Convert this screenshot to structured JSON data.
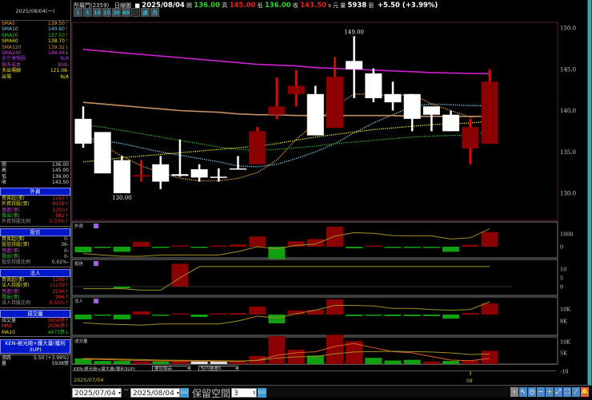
{
  "header": {
    "date": "2025/08/04(一)",
    "stock": "所羅門(2359)",
    "chart_type": "日線圖",
    "bar_date": "2025/08/04",
    "open_label": "開",
    "open": "136.00",
    "high_label": "高",
    "high": "145.00",
    "low_label": "低",
    "low": "136.00",
    "close_label": "收",
    "close": "143.50",
    "unit": "s 元",
    "vol_label": "量",
    "volume": "5938",
    "vol_unit": "張",
    "change": "+5.50 (+3.99%)",
    "intervals": [
      "1",
      "5",
      "10",
      "15",
      "30",
      "60",
      "日",
      "週",
      "月"
    ]
  },
  "indicators": [
    {
      "name": "SMA5",
      "value": "139.50",
      "trend": "↑",
      "color": "#e8a040"
    },
    {
      "name": "SMA10",
      "value": "140.60",
      "trend": "↑",
      "color": "#80c8f0"
    },
    {
      "name": "SMA20",
      "value": "137.50",
      "trend": "↑",
      "color": "#30c030"
    },
    {
      "name": "SMA60",
      "value": "138.70",
      "trend": "↑",
      "color": "#e8e020"
    },
    {
      "name": "SMA120",
      "value": "139.32",
      "trend": "↓",
      "color": "#c89060"
    },
    {
      "name": "SMA240",
      "value": "144.46",
      "trend": "↓",
      "color": "#d040e0"
    },
    {
      "name": "多空達陣圈",
      "value": "N/A",
      "trend": "",
      "color": "#a040e0"
    },
    {
      "name": "做多成本",
      "value": "858",
      "trend": "-",
      "color": "#c040c0"
    },
    {
      "name": "多出場線",
      "value": "121.08",
      "trend": "-",
      "color": "#e8e020"
    },
    {
      "name": "出場",
      "value": "N/A",
      "trend": "",
      "color": "#e8e020"
    }
  ],
  "ohlc": [
    {
      "label": "開",
      "value": "136.00"
    },
    {
      "label": "高",
      "value": "145.00"
    },
    {
      "label": "低",
      "value": "136.00"
    },
    {
      "label": "收",
      "value": "143.50"
    }
  ],
  "foreign": {
    "title": "外資",
    "rows": [
      {
        "label": "買賣超(張)",
        "value": "1167↑",
        "color": "#e8e020"
      },
      {
        "label": "外資持股(張)",
        "value": "9109↑",
        "color": "#e8e020"
      },
      {
        "label": "買進(張)",
        "value": "2350↑",
        "color": "#d040d0"
      },
      {
        "label": "賣出(張)",
        "value": "982↑",
        "color": "#30d030"
      },
      {
        "label": "外資持股比例",
        "value": "5.33%↑",
        "color": "#999"
      }
    ]
  },
  "trust": {
    "title": "投信",
    "rows": [
      {
        "label": "買賣超(張)",
        "value": "0-",
        "color": "#e8e020"
      },
      {
        "label": "投信持股(張)",
        "value": "36-",
        "color": "#e8e020"
      },
      {
        "label": "買進(張)",
        "value": "0-",
        "color": "#d040d0"
      },
      {
        "label": "賣出(張)",
        "value": "0-",
        "color": "#30d030"
      },
      {
        "label": "投信持股比例",
        "value": "0.02%-",
        "color": "#999"
      }
    ]
  },
  "institutional": {
    "title": "法人",
    "rows": [
      {
        "label": "買賣超(張)",
        "value": "1299↑",
        "color": "#e8e020"
      },
      {
        "label": "法人持股(張)",
        "value": "11239↑",
        "color": "#e8e020"
      },
      {
        "label": "買進(張)",
        "value": "2296↑",
        "color": "#d040d0"
      },
      {
        "label": "賣出(張)",
        "value": "996↑",
        "color": "#30d030"
      },
      {
        "label": "法人持股比例",
        "value": "6.55%↑",
        "color": "#999"
      }
    ]
  },
  "volume_box": {
    "title": "成交量",
    "rows": [
      {
        "label": "成交量",
        "value": "5938張↑",
        "color": "#ccc"
      },
      {
        "label": "MA5",
        "value": "2506張↑",
        "color": "#e04040"
      },
      {
        "label": "MA10",
        "value": "4473張↓",
        "color": "#e8e020"
      }
    ]
  },
  "strategy": "KEN-極光砲+爆大量(獲利3UP)",
  "summary": [
    {
      "label": "漲跌",
      "value": "5.50 (+3.99%)"
    },
    {
      "label": "量",
      "value": "5938張"
    }
  ],
  "panels": {
    "foreign": "外資",
    "trust": "投信",
    "institutional": "法人",
    "volume": "成交量"
  },
  "study_bar": {
    "strategy": "KEN-極光砲+爆大量(獲利3UP)",
    "overlay": "疊加個品",
    "volume_ma": "短均量圖5"
  },
  "time_axis": {
    "start": "2025/07/04",
    "tick": "08"
  },
  "bottom": {
    "from": "2025/07/04",
    "to": "2025/08/04",
    "go": "GO",
    "reserve_label": "保留空間",
    "reserve": "3",
    "go2": "GO"
  },
  "chart_data": {
    "type": "candlestick",
    "price_axis": {
      "ticks": [
        "150.0",
        "145.0",
        "140.0",
        "135.0",
        "130.0"
      ],
      "ylim": [
        127,
        150.5
      ]
    },
    "annotations": [
      {
        "text": "149.00",
        "bar": 14
      },
      {
        "text": "130.00",
        "bar": 2
      }
    ],
    "candles": [
      {
        "o": 139.0,
        "c": 136.0,
        "h": 140.5,
        "l": 135.5,
        "k": "down"
      },
      {
        "o": 137.4,
        "c": 132.4,
        "h": 137.4,
        "l": 132.4,
        "k": "down"
      },
      {
        "o": 134.0,
        "c": 130.0,
        "h": 134.5,
        "l": 130.0,
        "k": "down"
      },
      {
        "o": 132.2,
        "c": 132.0,
        "h": 134.0,
        "l": 131.4,
        "k": "up"
      },
      {
        "o": 133.5,
        "c": 131.4,
        "h": 134.5,
        "l": 130.5,
        "k": "down"
      },
      {
        "o": 132.3,
        "c": 132.1,
        "h": 136.5,
        "l": 132.0,
        "k": "down"
      },
      {
        "o": 132.9,
        "c": 131.9,
        "h": 133.5,
        "l": 131.4,
        "k": "down"
      },
      {
        "o": 132.0,
        "c": 131.9,
        "h": 133.0,
        "l": 131.4,
        "k": "down"
      },
      {
        "o": 133.0,
        "c": 132.9,
        "h": 134.5,
        "l": 132.9,
        "k": "down"
      },
      {
        "o": 133.5,
        "c": 137.5,
        "h": 138.0,
        "l": 133.5,
        "k": "up"
      },
      {
        "o": 139.5,
        "c": 140.5,
        "h": 144.0,
        "l": 139.0,
        "k": "up"
      },
      {
        "o": 142.0,
        "c": 143.0,
        "h": 144.9,
        "l": 140.5,
        "k": "up"
      },
      {
        "o": 142.0,
        "c": 137.0,
        "h": 143.0,
        "l": 137.0,
        "k": "down"
      },
      {
        "o": 137.9,
        "c": 144.1,
        "h": 146.5,
        "l": 137.9,
        "k": "up"
      },
      {
        "o": 146.0,
        "c": 145.0,
        "h": 149.0,
        "l": 141.5,
        "k": "down"
      },
      {
        "o": 144.5,
        "c": 141.5,
        "h": 145.1,
        "l": 141.0,
        "k": "down"
      },
      {
        "o": 142.0,
        "c": 141.0,
        "h": 143.5,
        "l": 140.0,
        "k": "down"
      },
      {
        "o": 142.0,
        "c": 139.0,
        "h": 142.0,
        "l": 137.5,
        "k": "down"
      },
      {
        "o": 140.5,
        "c": 139.5,
        "h": 140.5,
        "l": 137.5,
        "k": "down"
      },
      {
        "o": 139.5,
        "c": 137.5,
        "h": 140.0,
        "l": 137.5,
        "k": "down"
      },
      {
        "o": 135.4,
        "c": 138.0,
        "h": 139.0,
        "l": 133.5,
        "k": "up"
      },
      {
        "o": 136.0,
        "c": 143.5,
        "h": 145.0,
        "l": 136.0,
        "k": "up"
      }
    ],
    "ma": [
      {
        "name": "SMA5",
        "color": "#e8a040",
        "dash": true,
        "values": [
          136.7,
          135.8,
          134.5,
          133.3,
          132.5,
          131.8,
          131.5,
          131.5,
          131.8,
          132.5,
          134.0,
          136.5,
          138.5,
          140.5,
          142.0,
          142.0,
          141.7,
          142.0,
          140.8,
          140.0,
          139.2,
          139.5
        ]
      },
      {
        "name": "SMA10",
        "color": "#80c8f0",
        "dash": true,
        "values": [
          136.7,
          136.4,
          136.0,
          135.5,
          135.0,
          134.6,
          134.2,
          133.8,
          133.3,
          133.2,
          133.5,
          134.2,
          135.0,
          136.0,
          137.3,
          138.5,
          139.5,
          140.5,
          140.8,
          140.7,
          140.6,
          140.6
        ]
      },
      {
        "name": "SMA20",
        "color": "#30b030",
        "dash": true,
        "values": [
          138.3,
          138.0,
          137.6,
          137.2,
          136.8,
          136.4,
          136.0,
          135.6,
          135.3,
          135.2,
          135.3,
          135.5,
          135.7,
          136.0,
          136.2,
          136.4,
          136.6,
          136.8,
          136.9,
          137.0,
          137.0,
          137.5
        ]
      },
      {
        "name": "SMA60",
        "color": "#e8e020",
        "dash": true,
        "values": [
          133.8,
          134.0,
          134.3,
          134.5,
          134.7,
          134.9,
          135.1,
          135.3,
          135.5,
          135.7,
          136.0,
          136.4,
          136.8,
          137.1,
          137.4,
          137.7,
          137.9,
          138.1,
          138.3,
          138.4,
          138.5,
          138.7
        ]
      },
      {
        "name": "SMA120",
        "color": "#c89060",
        "dash": false,
        "values": [
          141.0,
          140.8,
          140.6,
          140.4,
          140.2,
          140.0,
          139.9,
          139.8,
          139.6,
          139.5,
          139.5,
          139.4,
          139.4,
          139.4,
          139.4,
          139.4,
          139.4,
          139.3,
          139.3,
          139.3,
          139.3,
          139.3
        ]
      },
      {
        "name": "SMA240",
        "color": "#d020d0",
        "dash": false,
        "values": [
          147.4,
          147.2,
          147.0,
          146.8,
          146.6,
          146.4,
          146.2,
          146.0,
          145.8,
          145.6,
          145.5,
          145.4,
          145.2,
          145.1,
          145.0,
          144.9,
          144.8,
          144.7,
          144.6,
          144.55,
          144.5,
          144.46
        ]
      }
    ],
    "sub": [
      {
        "id": "foreign",
        "ticks": [
          {
            "t": "1000",
            "v": 1000
          },
          {
            "t": "0",
            "v": 0
          }
        ],
        "bars": [
          -440,
          -60,
          -400,
          380,
          -50,
          40,
          -30,
          60,
          180,
          800,
          -950,
          430,
          600,
          1560,
          -120,
          40,
          -60,
          -50,
          -40,
          -400,
          150,
          1150
        ],
        "line": [
          -540,
          -650,
          -750,
          -750,
          -650,
          -650,
          -650,
          -650,
          -380,
          0,
          -170,
          100,
          200,
          820,
          1100,
          1050,
          870,
          850,
          850,
          600,
          700,
          1400
        ]
      },
      {
        "id": "trust",
        "ticks": [
          {
            "t": "10",
            "v": 10
          },
          {
            "t": "5",
            "v": 5
          },
          {
            "t": "0",
            "v": 0
          }
        ],
        "bars": [
          0,
          0,
          -1,
          0,
          0,
          13,
          0,
          0,
          0,
          0,
          0,
          0,
          0,
          0,
          0,
          0,
          0,
          0,
          0,
          0,
          0,
          0
        ],
        "line": [
          -1.2,
          -1.2,
          -1.2,
          -2,
          -2,
          5,
          11.4,
          11.4,
          11.4,
          11.4,
          11.4,
          11.4,
          11.4,
          11.4,
          11.4,
          11.4,
          11.4,
          11.4,
          11.4,
          11.4,
          11.4,
          11.4
        ]
      },
      {
        "id": "institutional",
        "ticks": [
          {
            "t": "10K",
            "v": 10000
          },
          {
            "t": "8K",
            "v": 8000
          }
        ],
        "bars": [
          -560,
          -90,
          -560,
          370,
          -90,
          40,
          -280,
          50,
          190,
          930,
          -1020,
          465,
          560,
          1770,
          -180,
          -90,
          -180,
          -180,
          -180,
          -470,
          190,
          1299
        ],
        "line": [
          7700,
          7500,
          7400,
          7300,
          7500,
          7500,
          7500,
          7500,
          8000,
          8800,
          8500,
          9200,
          9800,
          10600,
          10600,
          10500,
          10100,
          10100,
          9900,
          9800,
          9900,
          11200
        ]
      },
      {
        "id": "volume",
        "ticks": [
          {
            "t": "10K",
            "v": 10000
          },
          {
            "t": "5K",
            "v": 5000
          },
          {
            "t": "-10",
            "v": -10
          }
        ],
        "bars": [
          2500,
          1400,
          1400,
          1100,
          1100,
          1800,
          1100,
          1100,
          1400,
          3600,
          12500,
          6400,
          3800,
          13100,
          10300,
          2800,
          1600,
          1900,
          1100,
          1400,
          1600,
          5938
        ],
        "colors": [
          "g",
          "g",
          "g",
          "r",
          "g",
          "r",
          "w",
          "w",
          "r",
          "r",
          "r",
          "r",
          "g",
          "r",
          "r",
          "g",
          "g",
          "g",
          "r",
          "g",
          "r",
          "r"
        ],
        "ma5": [
          2200,
          2000,
          1800,
          1600,
          1400,
          1400,
          1300,
          1200,
          1200,
          1700,
          3900,
          5100,
          5500,
          7900,
          9200,
          7300,
          5600,
          5000,
          3400,
          1800,
          1500,
          2506
        ],
        "ma10": [
          2500,
          2400,
          2200,
          2000,
          1800,
          1700,
          1600,
          1500,
          1400,
          1600,
          2700,
          3200,
          3400,
          4600,
          5400,
          5600,
          5700,
          5600,
          5400,
          5000,
          4300,
          4473
        ]
      }
    ]
  }
}
